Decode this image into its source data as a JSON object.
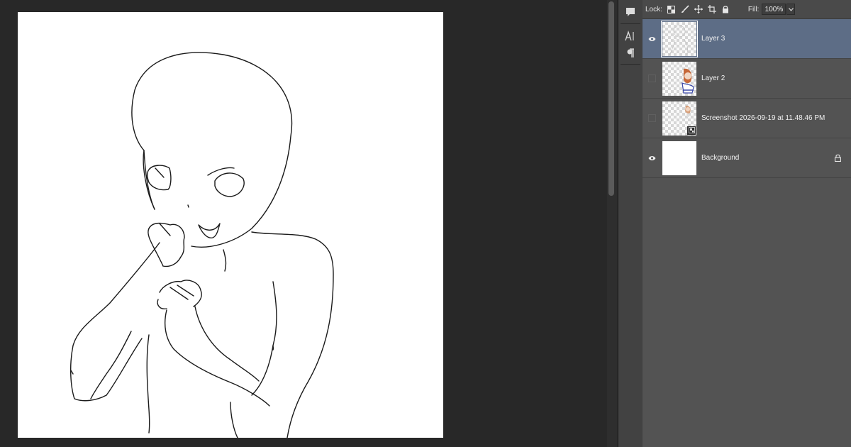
{
  "canvas": {
    "background": "#ffffff",
    "content": "line-sketch-figure"
  },
  "toolstrip": {
    "icons": [
      "comment-icon",
      "character-icon",
      "paragraph-icon"
    ]
  },
  "layers_panel": {
    "lock_label": "Lock:",
    "lock_icons": [
      "lock-transparent-pixels-icon",
      "lock-image-pixels-icon",
      "lock-position-icon",
      "lock-artboard-icon",
      "lock-all-icon"
    ],
    "fill_label": "Fill:",
    "fill_value": "100%",
    "selected_color": "#5d6d86",
    "layers": [
      {
        "name": "Layer 3",
        "visible": true,
        "selected": true
      },
      {
        "name": "Layer 2",
        "visible": false,
        "selected": false
      },
      {
        "name": "Screenshot 2026-09-19 at 11.48.46 PM",
        "visible": false,
        "selected": false,
        "smart_object": true
      },
      {
        "name": "Background",
        "visible": true,
        "selected": false,
        "locked": true
      }
    ]
  }
}
